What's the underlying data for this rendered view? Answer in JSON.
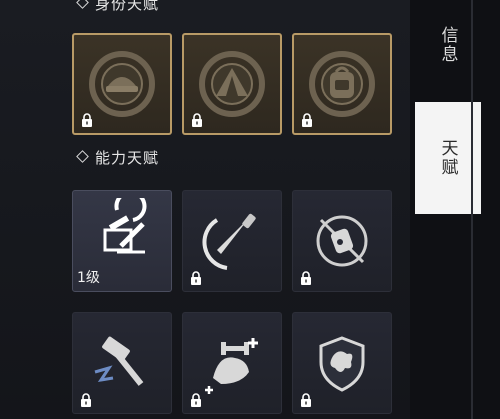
{
  "sections": {
    "identity": {
      "title": "身份天赋"
    },
    "ability": {
      "title": "能力天赋"
    }
  },
  "identity_cards": [
    {
      "icon": "helmet-emblem-icon",
      "locked": true
    },
    {
      "icon": "tent-emblem-icon",
      "locked": true
    },
    {
      "icon": "backpack-emblem-icon",
      "locked": true
    }
  ],
  "ability_cards": [
    {
      "icon": "crafting-tools-icon",
      "locked": false,
      "level": "1级"
    },
    {
      "icon": "knife-slash-icon",
      "locked": true
    },
    {
      "icon": "canister-circle-icon",
      "locked": true
    },
    {
      "icon": "hammer-smash-icon",
      "locked": true
    },
    {
      "icon": "flexed-arm-plus-icon",
      "locked": true
    },
    {
      "icon": "shield-splatter-icon",
      "locked": true
    }
  ],
  "tabs": [
    {
      "label": "信息",
      "active": false
    },
    {
      "label": "天赋",
      "active": true
    }
  ],
  "colors": {
    "identity_border": "#b89a66",
    "identity_bg": "#3b3326",
    "ability_bg": "#262833",
    "active_tab_bg": "#f4f4f4"
  }
}
